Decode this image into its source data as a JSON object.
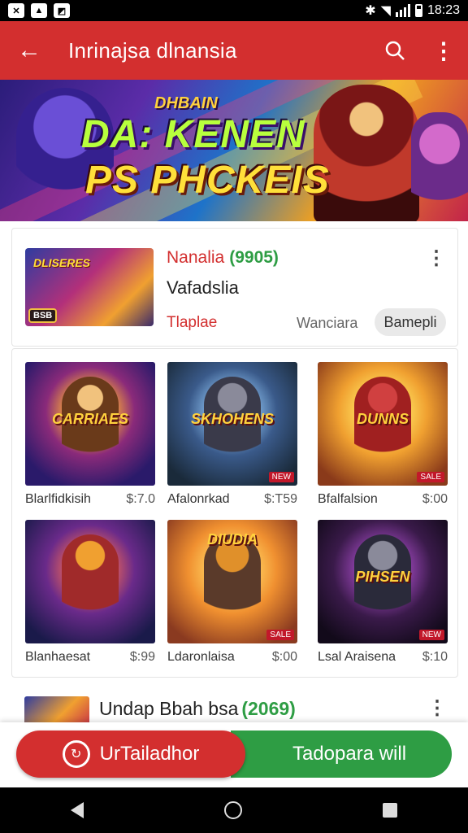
{
  "status_bar": {
    "time": "18:23"
  },
  "app_bar": {
    "title": "Inrinajsa dlnansia",
    "back_icon": "←",
    "more_icon": "⋮"
  },
  "banner": {
    "line1": "DHBAIN",
    "line2": "DA: KENEN",
    "line3": "PS PHCKEIS"
  },
  "featured": {
    "thumb_label": "DLISERES",
    "thumb_tag": "BSB",
    "title": "Nanalia",
    "title_tag": "(9905)",
    "subtitle": "Vafadslia",
    "link": "Tlaplae",
    "meta": "Wanciara",
    "button": "Bamepli"
  },
  "grid": {
    "items": [
      {
        "name": "Blarlfidkisih",
        "price": "$:7.0",
        "img_text": "CARRIAES",
        "badge": ""
      },
      {
        "name": "Afalonrkad",
        "price": "$:T59",
        "img_text": "SKHOHENS",
        "badge": "NEW"
      },
      {
        "name": "Bfalfalsion",
        "price": "$:00",
        "img_text": "DUNNS",
        "badge": "SALE"
      },
      {
        "name": "Blanhaesat",
        "price": "$:99",
        "img_text": "",
        "badge": ""
      },
      {
        "name": "Ldaronlaisa",
        "price": "$:00",
        "img_text": "DIUDIA",
        "badge": "SALE"
      },
      {
        "name": "Lsal Araisena",
        "price": "$:10",
        "img_text": "PIHSEN",
        "badge": "NEW"
      }
    ]
  },
  "list_item": {
    "title": "Undap Bbah bsa",
    "title_tag": "(2069)"
  },
  "actions": {
    "primary": "UrTailadhor",
    "secondary": "Tadopara will"
  },
  "colors": {
    "primary": "#d32f2f",
    "secondary": "#2e9d44"
  }
}
